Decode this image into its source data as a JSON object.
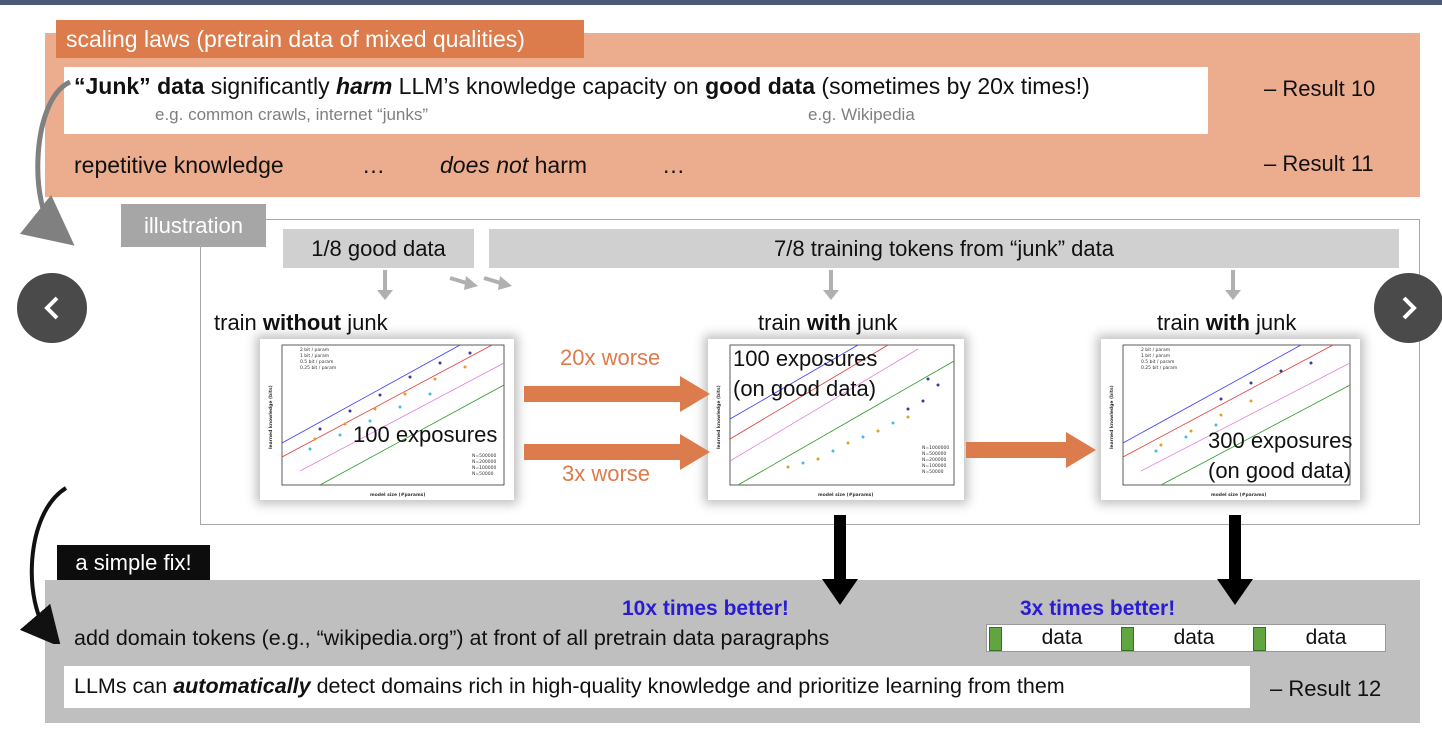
{
  "header_scaling": "scaling laws (pretrain data of mixed qualities)",
  "result10": {
    "junk": "“Junk” data",
    "significantly": " significantly ",
    "harm": "harm",
    "llm_capacity": " LLM’s knowledge capacity on ",
    "good_data": "good data",
    "sometimes": " (sometimes by 20x times!)",
    "eg_junk": "e.g. common crawls, internet “junks”",
    "eg_good": "e.g. Wikipedia",
    "label": "– Result 10"
  },
  "result11": {
    "repetitive": "repetitive knowledge",
    "ellipsis1": "…",
    "does_not": "does not",
    "harm": " harm",
    "ellipsis2": "…",
    "label": "– Result 11"
  },
  "illustration": {
    "tag": "illustration",
    "good_data_bar": "1/8 good data",
    "junk_data_bar": "7/8 training tokens from “junk” data",
    "captions": [
      {
        "pre": "train ",
        "bold": "without",
        "post": " junk"
      },
      {
        "pre": "train ",
        "bold": "with",
        "post": " junk"
      },
      {
        "pre": "train ",
        "bold": "with",
        "post": " junk"
      }
    ],
    "plot1_text": "100 exposures",
    "plot2_text_line1": "100 exposures",
    "plot2_text_line2": "(on good data)",
    "plot3_text_line1": "300 exposures",
    "plot3_text_line2": "(on good data)",
    "worse_20x": "20x worse",
    "worse_3x": "3x worse",
    "plot_xlabel": "model size (#params)",
    "plot_ylabel": "learned knowledge (bits)",
    "legend_lines": [
      "2 bit / param",
      "1 bit / param",
      "0.5 bit / param",
      "0.25 bit / param"
    ],
    "legend_n1": [
      "N=500000",
      "N=200000",
      "N=100000",
      "N=50000"
    ],
    "legend_n2": [
      "N=1000000",
      "N=500000",
      "N=200000",
      "N=100000",
      "N=50000"
    ]
  },
  "fix": {
    "header": "a simple fix!",
    "better_10x": "10x times better!",
    "better_3x": "3x times better!",
    "add_domain": "add domain tokens (e.g., “wikipedia.org”) at front of all pretrain data paragraphs",
    "data_labels": [
      "data",
      "data",
      "data"
    ],
    "result12_pre": "LLMs can ",
    "result12_auto": "automatically",
    "result12_post": " detect domains rich in high-quality knowledge and prioritize learning from them",
    "result12_label": "– Result 12"
  },
  "colors": {
    "orange_header": "#dc7b4c",
    "orange_bg": "#ecad8f",
    "gray_section": "#bfbfbf",
    "blue_better": "#2a1cd4",
    "green_marker": "#5fa640"
  },
  "icons": {
    "prev": "chevron-left-icon",
    "next": "chevron-right-icon"
  }
}
